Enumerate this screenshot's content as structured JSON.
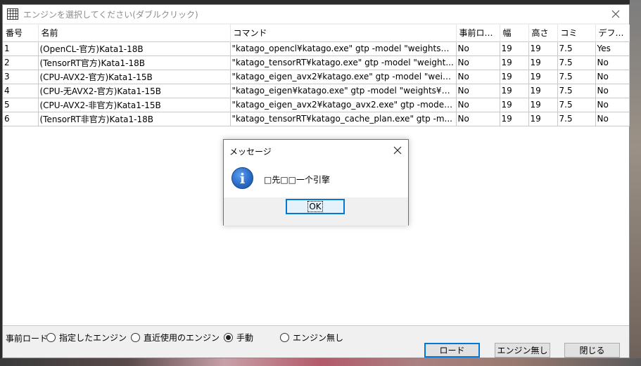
{
  "window": {
    "title": "エンジンを選択してください(ダブルクリック)"
  },
  "table": {
    "columns": [
      "番号",
      "名前",
      "コマンド",
      "事前ロード",
      "幅",
      "高さ",
      "コミ",
      "デフォ..."
    ],
    "rows": [
      [
        "1",
        "(OpenCL-官方)Kata1-18B",
        "\"katago_opencl¥katago.exe\" gtp -model \"weights¥...",
        "No",
        "19",
        "19",
        "7.5",
        "Yes"
      ],
      [
        "2",
        "(TensorRT官方)Kata1-18B",
        "\"katago_tensorRT¥katago.exe\" gtp -model \"weight...",
        "No",
        "19",
        "19",
        "7.5",
        "No"
      ],
      [
        "3",
        "(CPU-AVX2-官方)Kata1-15B",
        "\"katago_eigen_avx2¥katago.exe\" gtp -model \"weig...",
        "No",
        "19",
        "19",
        "7.5",
        "No"
      ],
      [
        "4",
        "(CPU-无AVX2-官方)Kata1-15B",
        "\"katago_eigen¥katago.exe\" gtp -model \"weights¥k...",
        "No",
        "19",
        "19",
        "7.5",
        "No"
      ],
      [
        "5",
        "(CPU-AVX2-非官方)Kata1-15B",
        "\"katago_eigen_avx2¥katago_avx2.exe\" gtp -model ...",
        "No",
        "19",
        "19",
        "7.5",
        "No"
      ],
      [
        "6",
        "(TensorRT非官方)Kata1-18B",
        "\"katago_tensorRT¥katago_cache_plan.exe\" gtp -m...",
        "No",
        "19",
        "19",
        "7.5",
        "No"
      ]
    ]
  },
  "footer": {
    "preload_label": "事前ロード",
    "radios": [
      {
        "label": "指定したエンジン",
        "checked": false
      },
      {
        "label": "直近使用のエンジン",
        "checked": false
      },
      {
        "label": "手動",
        "checked": true
      },
      {
        "label": "エンジン無し",
        "checked": false
      }
    ],
    "buttons": {
      "load": "ロード",
      "no_engine": "エンジン無し",
      "close": "閉じる"
    }
  },
  "dialog": {
    "title": "メッセージ",
    "message": "□先□□一个引擎",
    "ok": "OK",
    "icon": "info-icon"
  }
}
